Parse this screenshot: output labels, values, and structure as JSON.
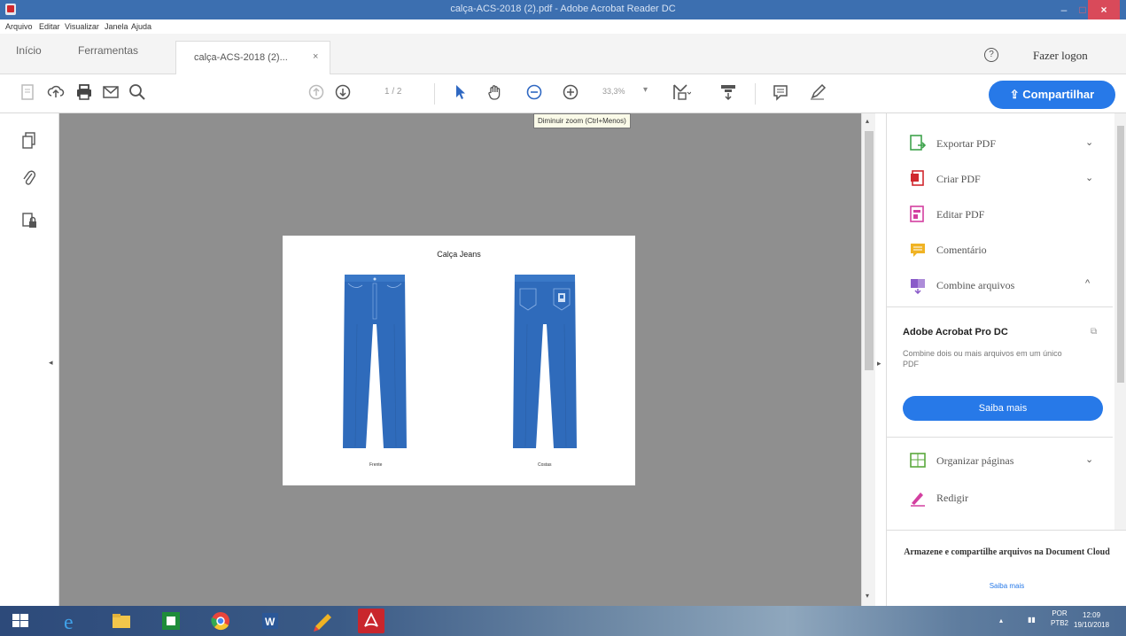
{
  "window": {
    "title": "calça-ACS-2018 (2).pdf - Adobe Acrobat Reader DC",
    "min": "–",
    "max": "□",
    "close": "×"
  },
  "menu": [
    "Arquivo",
    "Editar",
    "Visualizar",
    "Janela",
    "Ajuda"
  ],
  "tabs": {
    "home": "Início",
    "tools": "Ferramentas",
    "document": "calça-ACS-2018 (2)...",
    "document_close": "×"
  },
  "account": {
    "help": "?",
    "login": "Fazer logon"
  },
  "toolbar": {
    "page": "1 / 2",
    "zoom": "33,3%",
    "zoom_arrow": "▾",
    "share": "Compartilhar",
    "tooltip": "Diminuir zoom (Ctrl+Menos)"
  },
  "document": {
    "title": "Calça Jeans",
    "front_caption": "Frente",
    "back_caption": "Costas",
    "pants_color": "#2f6bbb"
  },
  "right_pane": {
    "tools": [
      {
        "label": "Exportar PDF",
        "chevron": "⌄",
        "icon": "export-pdf-icon"
      },
      {
        "label": "Criar PDF",
        "chevron": "⌄",
        "icon": "create-pdf-icon"
      },
      {
        "label": "Editar PDF",
        "chevron": "",
        "icon": "edit-pdf-icon"
      },
      {
        "label": "Comentário",
        "chevron": "",
        "icon": "comment-icon"
      },
      {
        "label": "Combine arquivos",
        "chevron": "^",
        "icon": "combine-files-icon"
      }
    ],
    "promo": {
      "title": "Adobe Acrobat Pro DC",
      "desc": "Combine dois ou mais arquivos em um único PDF",
      "button": "Saiba mais"
    },
    "tools2": [
      {
        "label": "Organizar páginas",
        "chevron": "⌄",
        "icon": "organize-pages-icon"
      },
      {
        "label": "Redigir",
        "chevron": "",
        "icon": "redact-icon"
      }
    ],
    "cloud": {
      "text": "Armazene e compartilhe arquivos na Document Cloud",
      "link": "Saiba mais"
    }
  },
  "taskbar": {
    "lang": "POR",
    "lang2": "PTB2",
    "time": "12:09",
    "date": "19/10/2018"
  },
  "colors": {
    "accent": "#2779e8",
    "titlebar": "#3c6fb0",
    "pants": "#2f6bbb"
  }
}
